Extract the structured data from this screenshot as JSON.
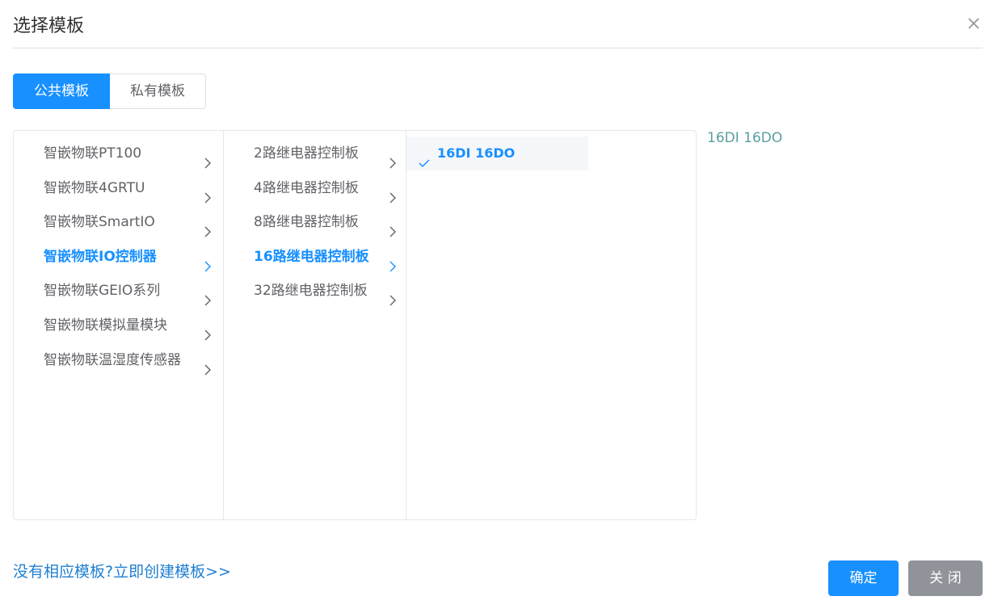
{
  "dialog": {
    "title": "选择模板"
  },
  "tabs": [
    {
      "label": "公共模板",
      "active": true
    },
    {
      "label": "私有模板",
      "active": false
    }
  ],
  "cascader": {
    "level1": [
      {
        "label": "智嵌物联PT100"
      },
      {
        "label": "智嵌物联4GRTU"
      },
      {
        "label": "智嵌物联SmartIO"
      },
      {
        "label": "智嵌物联IO控制器",
        "active": true
      },
      {
        "label": "智嵌物联GEIO系列"
      },
      {
        "label": "智嵌物联模拟量模块"
      },
      {
        "label": "智嵌物联温湿度传感器"
      }
    ],
    "level2": [
      {
        "label": "2路继电器控制板"
      },
      {
        "label": "4路继电器控制板"
      },
      {
        "label": "8路继电器控制板"
      },
      {
        "label": "16路继电器控制板",
        "active": true
      },
      {
        "label": "32路继电器控制板"
      }
    ],
    "level3": [
      {
        "label": "16DI 16DO",
        "selected": true
      }
    ]
  },
  "selected_value": "16DI 16DO",
  "footer": {
    "create_link": "没有相应模板?立即创建模板>>",
    "confirm_label": "确定",
    "close_label": "关 闭"
  },
  "colors": {
    "primary": "#1890ff",
    "close_button": "#909399",
    "selected_text": "#5a9ea0",
    "link": "#1f7fd1"
  }
}
